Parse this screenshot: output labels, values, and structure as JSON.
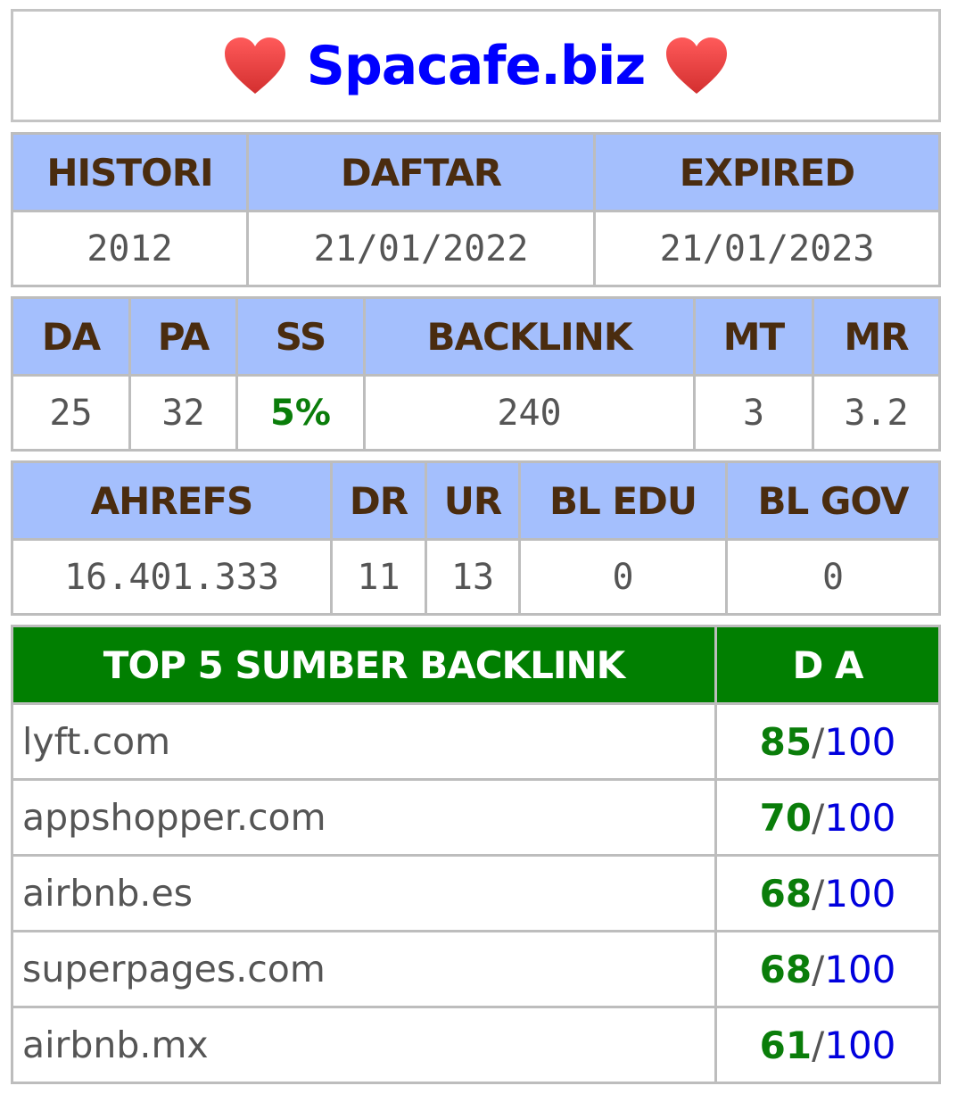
{
  "header": {
    "site": "Spacafe.biz",
    "left_icon": "heart-icon",
    "right_icon": "heart-icon",
    "heart_color": "#e53935"
  },
  "history_table": {
    "headers": [
      "HISTORI",
      "DAFTAR",
      "EXPIRED"
    ],
    "values": [
      "2012",
      "21/01/2022",
      "21/01/2023"
    ]
  },
  "metrics_table": {
    "headers": [
      "DA",
      "PA",
      "SS",
      "BACKLINK",
      "MT",
      "MR"
    ],
    "values": [
      "25",
      "32",
      "5%",
      "240",
      "3",
      "3.2"
    ]
  },
  "ahrefs_table": {
    "headers": [
      "AHREFS",
      "DR",
      "UR",
      "BL EDU",
      "BL GOV"
    ],
    "values": [
      "16.401.333",
      "11",
      "13",
      "0",
      "0"
    ]
  },
  "top_backlinks": {
    "header_source": "TOP 5 SUMBER BACKLINK",
    "header_da": "D A",
    "rows": [
      {
        "site": "lyft.com",
        "da": "85",
        "slash": "/",
        "max": "100"
      },
      {
        "site": "appshopper.com",
        "da": "70",
        "slash": "/",
        "max": "100"
      },
      {
        "site": "airbnb.es",
        "da": "68",
        "slash": "/",
        "max": "100"
      },
      {
        "site": "superpages.com",
        "da": "68",
        "slash": "/",
        "max": "100"
      },
      {
        "site": "airbnb.mx",
        "da": "61",
        "slash": "/",
        "max": "100"
      }
    ]
  },
  "colors": {
    "header_blue": "#a4bffd",
    "header_text": "#4a2c0f",
    "green_header": "#017f01",
    "title_blue": "#0000ff",
    "ss_green": "#0a7d0a"
  }
}
